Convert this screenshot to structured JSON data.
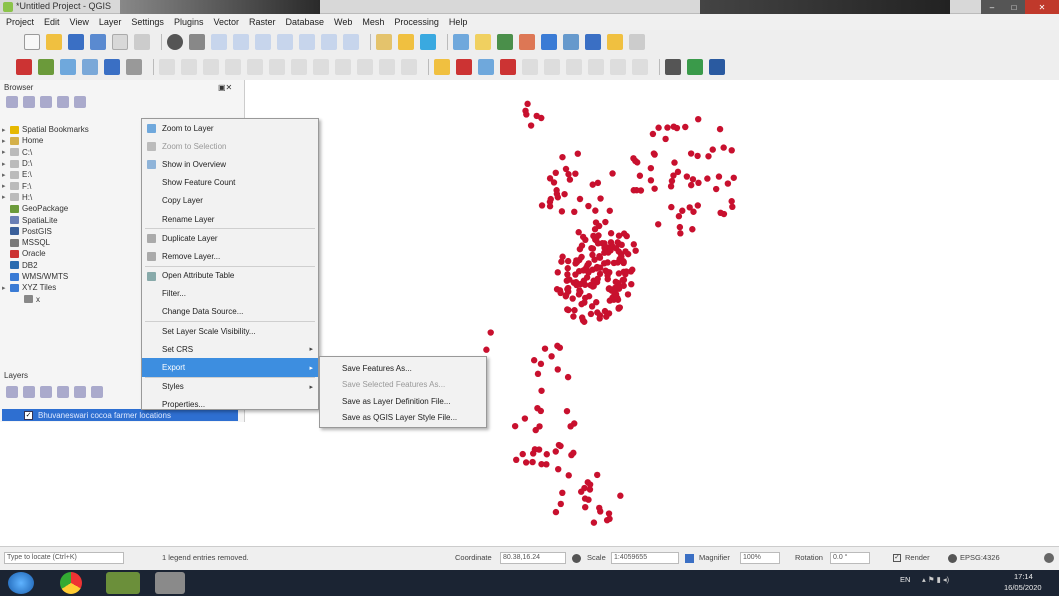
{
  "window": {
    "title": "*Untitled Project - QGIS"
  },
  "menubar": [
    "Project",
    "Edit",
    "View",
    "Layer",
    "Settings",
    "Plugins",
    "Vector",
    "Raster",
    "Database",
    "Web",
    "Mesh",
    "Processing",
    "Help"
  ],
  "browser": {
    "title": "Browser",
    "items": [
      {
        "label": "Spatial Bookmarks",
        "color": "#e6b800"
      },
      {
        "label": "Home",
        "color": "#d4b04a"
      },
      {
        "label": "C:\\",
        "color": "#bbb"
      },
      {
        "label": "D:\\",
        "color": "#bbb"
      },
      {
        "label": "E:\\",
        "color": "#bbb"
      },
      {
        "label": "F:\\",
        "color": "#bbb"
      },
      {
        "label": "H:\\",
        "color": "#bbb"
      },
      {
        "label": "GeoPackage",
        "color": "#6b9a3a"
      },
      {
        "label": "SpatiaLite",
        "color": "#6a7fb5"
      },
      {
        "label": "PostGIS",
        "color": "#3a5f9a"
      },
      {
        "label": "MSSQL",
        "color": "#7a7a7a"
      },
      {
        "label": "Oracle",
        "color": "#c33"
      },
      {
        "label": "DB2",
        "color": "#2b6cb0"
      },
      {
        "label": "WMS/WMTS",
        "color": "#3a7bd5"
      },
      {
        "label": "XYZ Tiles",
        "color": "#3a7bd5"
      },
      {
        "label": "x",
        "color": "#888"
      }
    ]
  },
  "layers": {
    "title": "Layers",
    "layer_name": "Bhuvaneswari cocoa farmer locations",
    "checked": "✓"
  },
  "context_menu": {
    "items": [
      {
        "label": "Zoom to Layer",
        "color": "#6fa8dc"
      },
      {
        "label": "Zoom to Selection",
        "dim": true,
        "color": "#bbb"
      },
      {
        "label": "Show in Overview",
        "color": "#8fb4d9"
      },
      {
        "label": "Show Feature Count",
        "color": ""
      },
      {
        "label": "Copy Layer",
        "color": ""
      },
      {
        "label": "Rename Layer",
        "color": ""
      },
      {
        "label": "Duplicate Layer",
        "color": "#aaa",
        "sep": true
      },
      {
        "label": "Remove Layer...",
        "color": "#aaa"
      },
      {
        "label": "Open Attribute Table",
        "color": "#8aa",
        "sep": true
      },
      {
        "label": "Filter...",
        "color": ""
      },
      {
        "label": "Change Data Source...",
        "color": ""
      },
      {
        "label": "Set Layer Scale Visibility...",
        "color": "",
        "sep": true
      },
      {
        "label": "Set CRS",
        "color": "",
        "sub": true
      },
      {
        "label": "Export",
        "color": "",
        "sub": true,
        "highlight": true
      },
      {
        "label": "Styles",
        "color": "",
        "sub": true,
        "sep": true
      },
      {
        "label": "Properties...",
        "color": ""
      }
    ]
  },
  "export_submenu": [
    {
      "label": "Save Features As..."
    },
    {
      "label": "Save Selected Features As...",
      "dim": true
    },
    {
      "label": "Save as Layer Definition File..."
    },
    {
      "label": "Save as QGIS Layer Style File..."
    }
  ],
  "statusbar": {
    "locate_placeholder": "Type to locate (Ctrl+K)",
    "legend_msg": "1 legend entries removed.",
    "coordinate_label": "Coordinate",
    "coordinate": "80.38,16.24",
    "scale_label": "Scale",
    "scale": "1:4059655",
    "magnifier_label": "Magnifier",
    "magnifier": "100%",
    "rotation_label": "Rotation",
    "rotation": "0.0 °",
    "render_label": "Render",
    "crs": "EPSG:4326"
  },
  "taskbar": {
    "lang": "EN",
    "time": "17:14",
    "date": "16/05/2020"
  }
}
